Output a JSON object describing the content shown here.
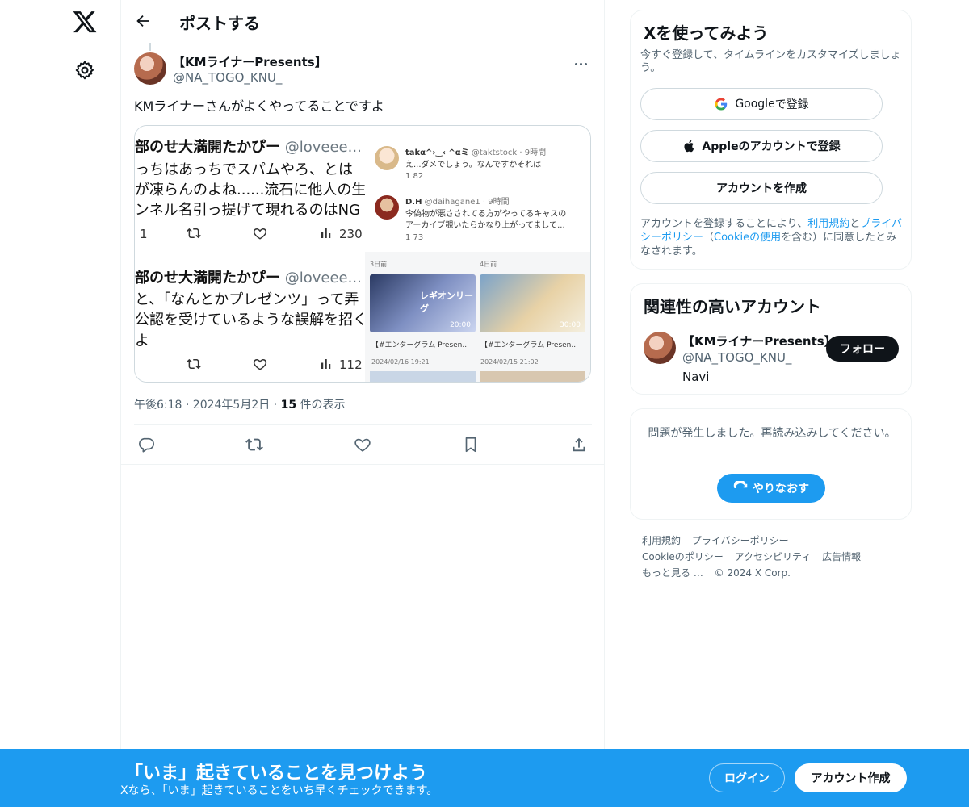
{
  "rail": {
    "logo_icon": "x-logo-icon",
    "settings_icon": "gear-icon"
  },
  "header": {
    "back_icon": "arrow-left-icon",
    "title": "ポストする"
  },
  "post": {
    "author_name": "【KMライナーPresents】",
    "author_handle": "@NA_TOGO_KNU_",
    "text": "KMライナーさんがよくやってることですよ",
    "timestamp": "午後6:18 · 2024年5月2日 · ",
    "view_count": "15",
    "view_label": " 件の表示",
    "media": {
      "left_name1": "部のせ大満開たかぴー",
      "left_handle1": "@loveee...",
      "left_line1": "っちはあっちでスパムやろ、とは",
      "left_line2": "が凍らんのよね......流石に他人の生",
      "left_line3": "ンネル名引っ提げて現れるのはNG",
      "left_count1a": "1",
      "left_count1b": "230",
      "left_name2": "部のせ大満開たかぴー",
      "left_handle2": "@loveee...",
      "left_line4": "と、「なんとかプレゼンツ」って弄",
      "left_line5": "公認を受けているような誤解を招く",
      "left_line6": "よ",
      "left_count2": "112",
      "right_user1": "takα^›‿‹ ^αミ",
      "right_handle1": "@taktstock · 9時間",
      "right_text1": "え...ダメでしょう。なんですかそれは",
      "right_counts1": "1    82",
      "right_user2": "D.H",
      "right_handle2": "@daihagane1 · 9時間",
      "right_text2a": "今偽物が悪さされてる方がやってるキャスの",
      "right_text2b": "アーカイブ覗いたらかなり上がってまして...",
      "right_counts2": "1   73",
      "grid_cap1": "【#エンターグラム Presen...",
      "grid_cap2": "【#エンターグラム Presen...",
      "grid_sub1": "2024/02/16 19:21",
      "grid_sub2": "2024/02/15 21:02",
      "grid_time1": "20:00",
      "grid_time2": "30:00",
      "grid_title1": "レギオンリーグ",
      "grid_hdr1": "3日前",
      "grid_hdr2": "4日前"
    },
    "actions": [
      "reply-icon",
      "retweet-icon",
      "like-icon",
      "bookmark-icon",
      "share-icon"
    ]
  },
  "signup_card": {
    "title": "Xを使ってみよう",
    "subtitle": "今すぐ登録して、タイムラインをカスタマイズしましょう。",
    "google_label_bold": "Google",
    "google_label": " で登録",
    "apple_label": "Appleのアカウントで登録",
    "create_label": "アカウントを作成",
    "legal_prefix": "アカウントを登録することにより、",
    "legal_terms": "利用規約",
    "legal_and": "と",
    "legal_privacy": "プライバシーポリシー",
    "legal_paren_open": "（",
    "legal_cookie": "Cookieの使用",
    "legal_suffix": "を含む）に同意したとみなされます。"
  },
  "related_card": {
    "title": "関連性の高いアカウント",
    "name": "【KMライナーPresents】",
    "handle": "@NA_TOGO_KNU_",
    "bio": "Navi",
    "follow_label": "フォロー"
  },
  "error_card": {
    "message": "問題が発生しました。再読み込みしてください。",
    "retry_label": "やりなおす"
  },
  "footer": {
    "links": [
      "利用規約",
      "プライバシーポリシー",
      "Cookieのポリシー",
      "アクセシビリティ",
      "広告情報",
      "もっと見る …"
    ],
    "copyright": "© 2024 X Corp."
  },
  "bottom_bar": {
    "title": "「いま」起きていることを見つけよう",
    "subtitle": "Xなら、「いま」起きていることをいち早くチェックできます。",
    "login_label": "ログイン",
    "signup_label": "アカウント作成"
  },
  "colors": {
    "accent": "#1d9bf0",
    "text": "#0f1419",
    "muted": "#536471"
  }
}
